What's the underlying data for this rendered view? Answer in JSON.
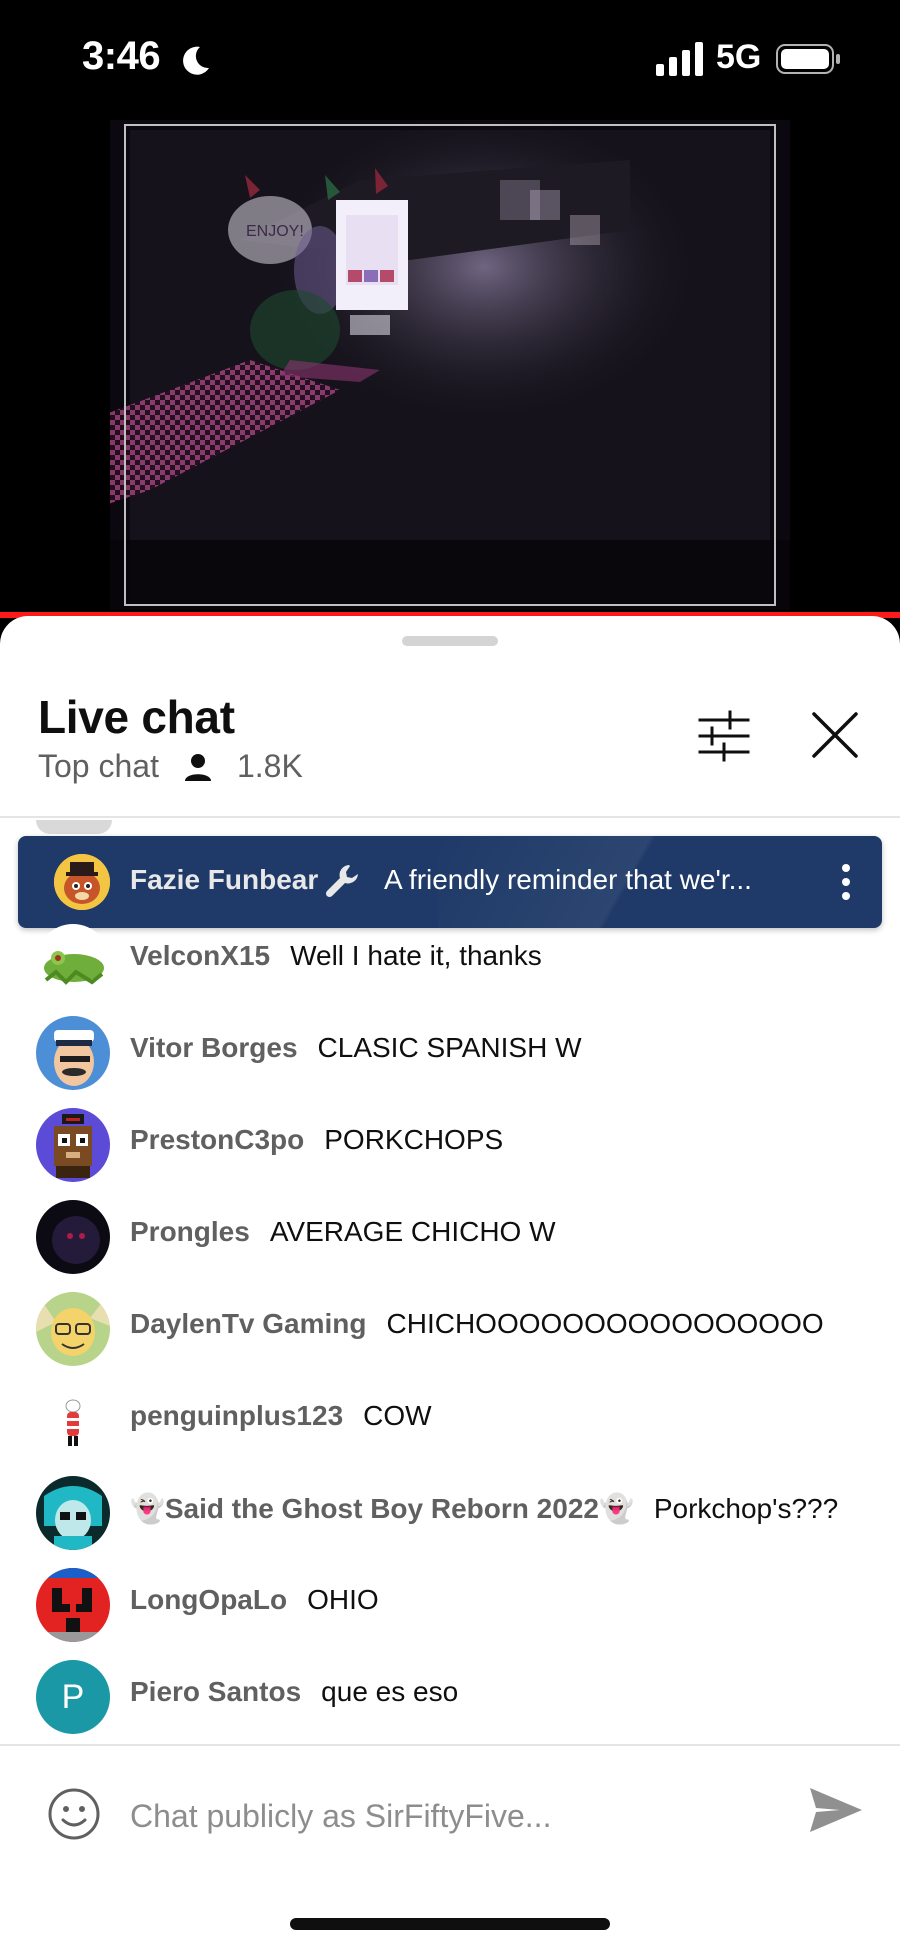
{
  "status": {
    "time": "3:46",
    "network": "5G"
  },
  "chat": {
    "title": "Live chat",
    "mode": "Top chat",
    "viewers": "1.8K",
    "pinned": {
      "author": "Fazie Funbear",
      "message": "A friendly reminder that we'r..."
    },
    "messages": [
      {
        "author": "VelconX15",
        "text": "Well I hate it, thanks"
      },
      {
        "author": "Vitor Borges",
        "text": "CLASIC SPANISH W"
      },
      {
        "author": "PrestonC3po",
        "text": "PORKCHOPS"
      },
      {
        "author": "Prongles",
        "text": "AVERAGE CHICHO W"
      },
      {
        "author": "DaylenTv Gaming",
        "text": "CHICHOOOOOOOOOOOOOOOO"
      },
      {
        "author": "penguinplus123",
        "text": "COW"
      },
      {
        "author": "👻Said the Ghost Boy Reborn 2022👻",
        "text": "Porkchop's???"
      },
      {
        "author": "LongOpaLo",
        "text": "OHIO"
      },
      {
        "author": "Piero Santos",
        "text": "que es eso",
        "avatar_letter": "P"
      }
    ],
    "input_placeholder": "Chat publicly as SirFiftyFive...",
    "colors": {
      "pinned_bg": "#1f3a68",
      "progress": "#ff1a1a",
      "piero_avatar": "#1b98a6"
    }
  }
}
